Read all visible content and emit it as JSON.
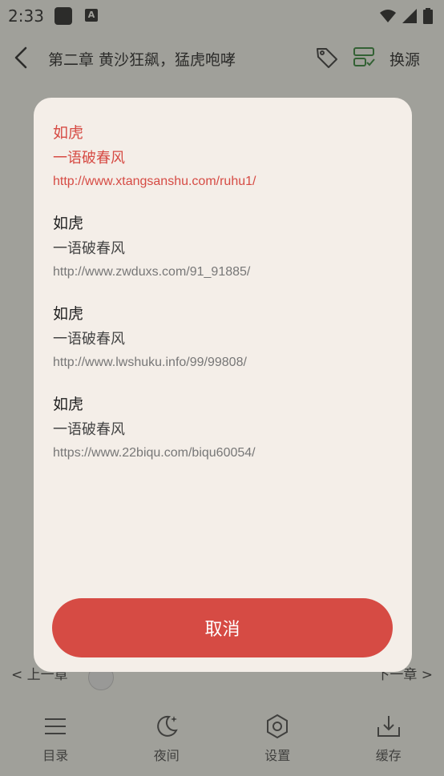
{
  "status_bar": {
    "time": "2:33"
  },
  "toolbar": {
    "chapter_title": "第二章 黄沙狂飙，猛虎咆哮",
    "switch_source_label": "换源"
  },
  "chapter_nav": {
    "prev_label": "上一章",
    "next_label": "下一章"
  },
  "bottom_bar": {
    "items": [
      {
        "label": "目录",
        "icon": "list-icon"
      },
      {
        "label": "夜间",
        "icon": "moon-icon"
      },
      {
        "label": "设置",
        "icon": "hexagon-settings-icon"
      },
      {
        "label": "缓存",
        "icon": "download-icon"
      }
    ]
  },
  "dialog": {
    "sources": [
      {
        "name": "如虎",
        "author": "一语破春风",
        "url": "http://www.xtangsanshu.com/ruhu1/",
        "selected": true
      },
      {
        "name": "如虎",
        "author": "一语破春风",
        "url": "http://www.zwduxs.com/91_91885/",
        "selected": false
      },
      {
        "name": "如虎",
        "author": "一语破春风",
        "url": "http://www.lwshuku.info/99/99808/",
        "selected": false
      },
      {
        "name": "如虎",
        "author": "一语破春风",
        "url": "https://www.22biqu.com/biqu60054/",
        "selected": false
      }
    ],
    "cancel_label": "取消"
  },
  "colors": {
    "accent": "#d64b44",
    "dialog_bg": "#f4eee8",
    "page_bg": "#e9e8e2",
    "source_icon": "#2e7d32"
  }
}
